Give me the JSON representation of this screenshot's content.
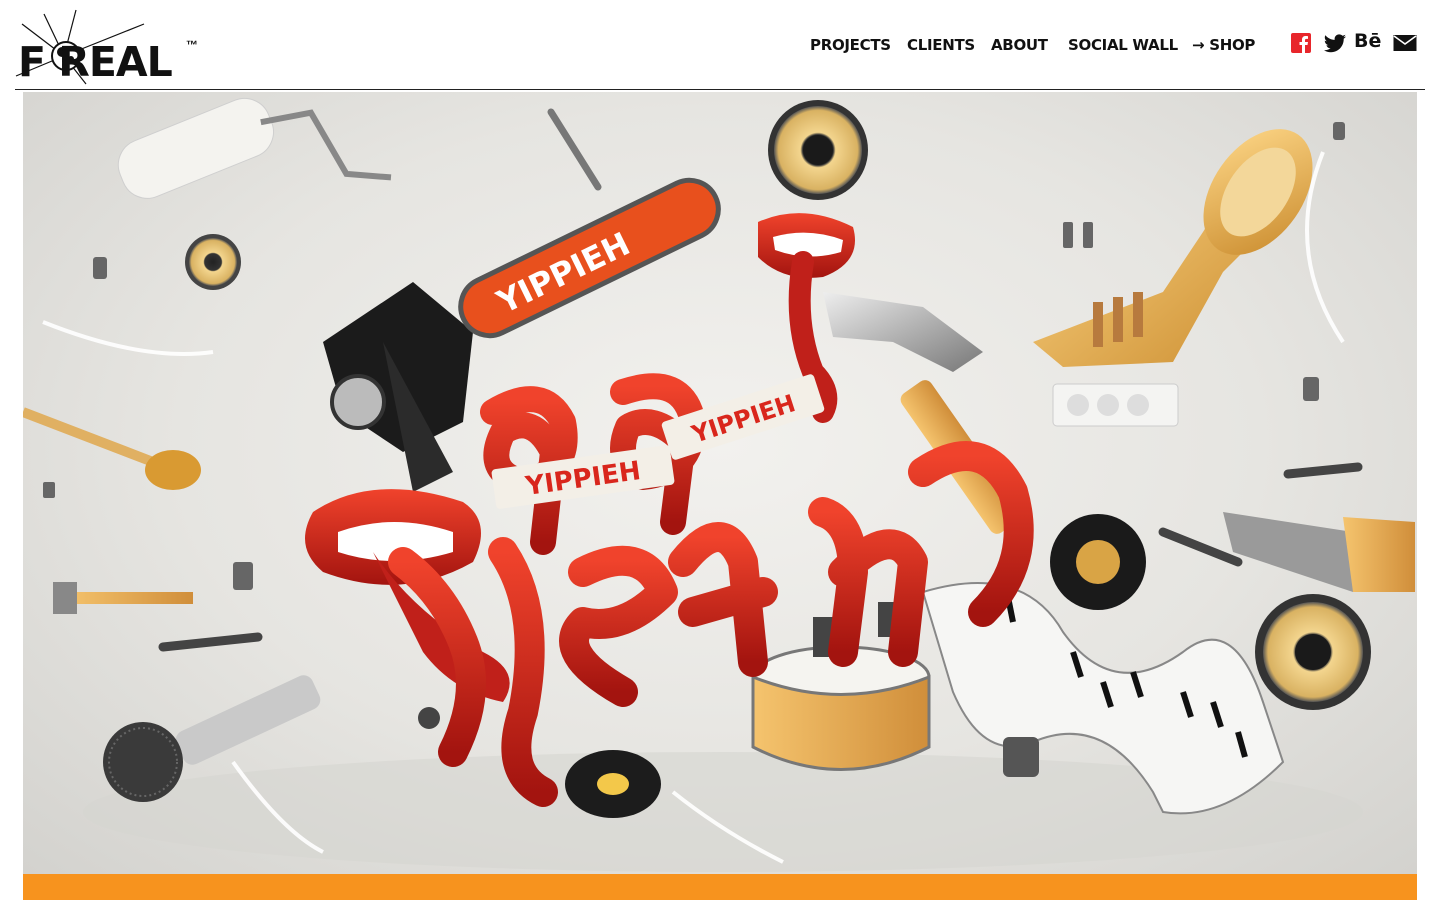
{
  "brand": {
    "name": "F REAL",
    "trademark": "™"
  },
  "nav": {
    "items": [
      {
        "label": "PROJECTS"
      },
      {
        "label": "CLIENTS"
      },
      {
        "label": "ABOUT"
      },
      {
        "label": "SOCIAL WALL"
      },
      {
        "label": "→ SHOP"
      }
    ]
  },
  "social": {
    "icons": [
      "facebook-icon",
      "twitter-icon",
      "behance-icon",
      "mail-icon"
    ],
    "behance_label": "Bē"
  },
  "hero": {
    "chainsaw_text": "YIPPIEH",
    "banner_text_left": "YIPPIEH",
    "banner_text_right": "YIPPIEH",
    "lettering_top": "ja ja",
    "lettering_bottom": "yeah"
  },
  "colors": {
    "accent_orange": "#f7931e",
    "facebook_red": "#e8262b",
    "lips_red": "#d9261c",
    "chainsaw_orange": "#e8501d"
  }
}
